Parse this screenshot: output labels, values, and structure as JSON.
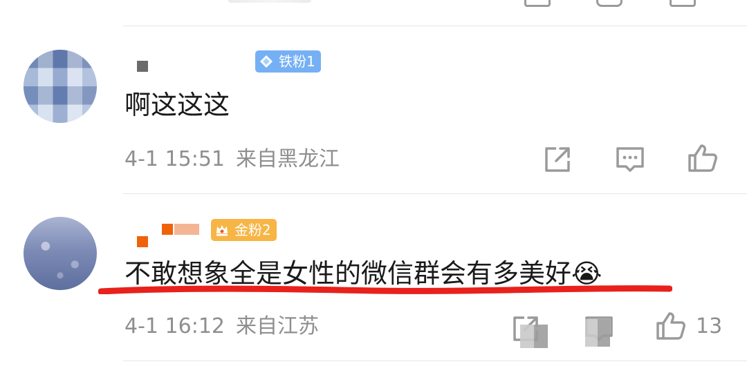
{
  "comments": [
    {
      "badge_label": "铁粉1",
      "text": "啊这这这",
      "time": "4-1 15:51",
      "location": "来自黑龙江",
      "likes": ""
    },
    {
      "badge_label": "金粉2",
      "text": "不敢想象全是女性的微信群会有多美好😭",
      "time": "4-1 16:12",
      "location": "来自江苏",
      "likes": "13"
    }
  ],
  "icons": {
    "share": "share-icon",
    "comment": "comment-icon",
    "like": "thumbs-up-icon",
    "badge_iron": "diamond-icon",
    "badge_gold": "crown-icon"
  },
  "colors": {
    "iron_badge": "#75b0f4",
    "gold_badge": "#f6b545",
    "meta_text": "#8e8e8e",
    "highlight_underline": "#e8211c"
  }
}
